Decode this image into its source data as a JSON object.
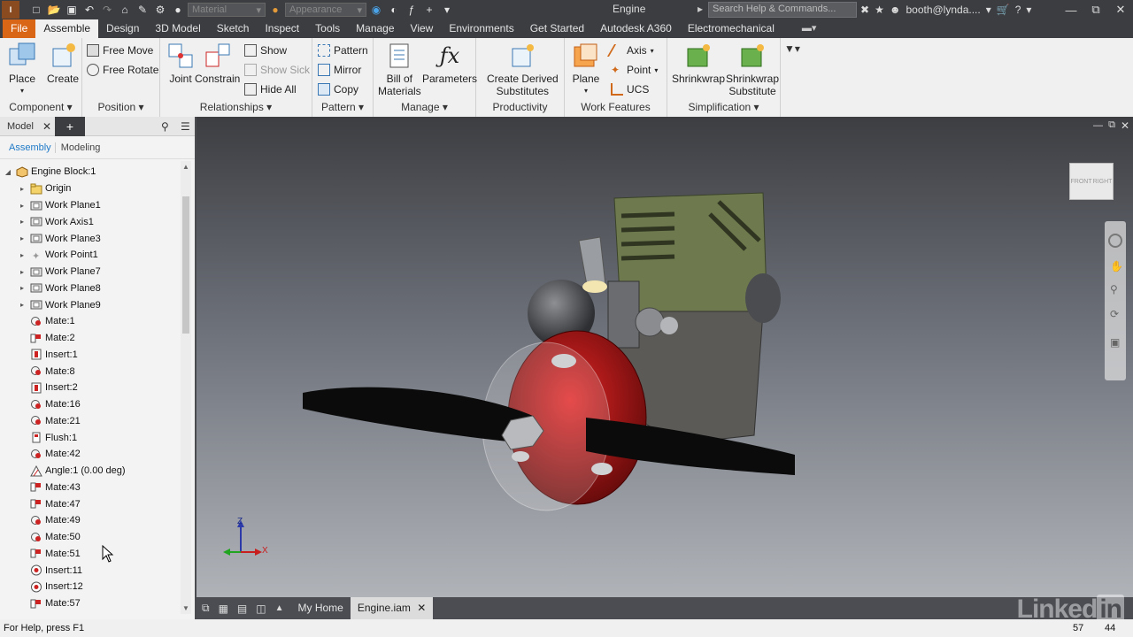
{
  "titlebar": {
    "app_logo": "I",
    "material_placeholder": "Material",
    "appearance_placeholder": "Appearance",
    "document_title": "Engine",
    "search_placeholder": "Search Help & Commands...",
    "user": "booth@lynda....",
    "help": "?"
  },
  "tabs": [
    "File",
    "Assemble",
    "Design",
    "3D Model",
    "Sketch",
    "Inspect",
    "Tools",
    "Manage",
    "View",
    "Environments",
    "Get Started",
    "Autodesk A360",
    "Electromechanical"
  ],
  "ribbon": {
    "component": {
      "title": "Component",
      "place": "Place",
      "create": "Create"
    },
    "position": {
      "title": "Position",
      "free_move": "Free Move",
      "free_rotate": "Free Rotate"
    },
    "relationships": {
      "title": "Relationships",
      "joint": "Joint",
      "constrain": "Constrain",
      "show": "Show",
      "show_sick": "Show Sick",
      "hide_all": "Hide All"
    },
    "pattern": {
      "title": "Pattern",
      "pattern": "Pattern",
      "mirror": "Mirror",
      "copy": "Copy"
    },
    "manage": {
      "title": "Manage",
      "bom_line1": "Bill of",
      "bom_line2": "Materials",
      "parameters": "Parameters"
    },
    "productivity": {
      "title": "Productivity",
      "line1": "Create Derived",
      "line2": "Substitutes"
    },
    "work_features": {
      "title": "Work Features",
      "plane": "Plane",
      "axis": "Axis",
      "point": "Point",
      "ucs": "UCS"
    },
    "simplification": {
      "title": "Simplification",
      "shrinkwrap": "Shrinkwrap",
      "sub_line1": "Shrinkwrap",
      "sub_line2": "Substitute"
    }
  },
  "browser": {
    "title": "Model",
    "tab_assembly": "Assembly",
    "tab_modeling": "Modeling",
    "root": "Engine Block:1",
    "items": [
      {
        "label": "Origin",
        "icon": "folder",
        "expandable": true
      },
      {
        "label": "Work Plane1",
        "icon": "part",
        "expandable": true
      },
      {
        "label": "Work Axis1",
        "icon": "part",
        "expandable": true
      },
      {
        "label": "Work Plane3",
        "icon": "part",
        "expandable": true
      },
      {
        "label": "Work Point1",
        "icon": "point",
        "expandable": true
      },
      {
        "label": "Work Plane7",
        "icon": "part",
        "expandable": true
      },
      {
        "label": "Work Plane8",
        "icon": "part",
        "expandable": true
      },
      {
        "label": "Work Plane9",
        "icon": "part",
        "expandable": true
      },
      {
        "label": "Mate:1",
        "icon": "mate",
        "expandable": false
      },
      {
        "label": "Mate:2",
        "icon": "mate-flush",
        "expandable": false
      },
      {
        "label": "Insert:1",
        "icon": "insert",
        "expandable": false
      },
      {
        "label": "Mate:8",
        "icon": "mate",
        "expandable": false
      },
      {
        "label": "Insert:2",
        "icon": "insert",
        "expandable": false
      },
      {
        "label": "Mate:16",
        "icon": "mate",
        "expandable": false
      },
      {
        "label": "Mate:21",
        "icon": "mate",
        "expandable": false
      },
      {
        "label": "Flush:1",
        "icon": "flush",
        "expandable": false
      },
      {
        "label": "Mate:42",
        "icon": "mate",
        "expandable": false
      },
      {
        "label": "Angle:1 (0.00 deg)",
        "icon": "angle",
        "expandable": false
      },
      {
        "label": "Mate:43",
        "icon": "mate-flush",
        "expandable": false
      },
      {
        "label": "Mate:47",
        "icon": "mate-flush",
        "expandable": false
      },
      {
        "label": "Mate:49",
        "icon": "mate",
        "expandable": false
      },
      {
        "label": "Mate:50",
        "icon": "mate",
        "expandable": false
      },
      {
        "label": "Mate:51",
        "icon": "mate-flush",
        "expandable": false
      },
      {
        "label": "Insert:11",
        "icon": "insert-round",
        "expandable": false
      },
      {
        "label": "Insert:12",
        "icon": "insert-round",
        "expandable": false
      },
      {
        "label": "Mate:57",
        "icon": "mate-flush",
        "expandable": false
      }
    ]
  },
  "viewcube": {
    "front": "FRONT",
    "right": "RIGHT"
  },
  "triad": {
    "z": "Z",
    "x": "X"
  },
  "bottom_tabs": {
    "home": "My Home",
    "doc": "Engine.iam"
  },
  "status": {
    "help": "For Help, press F1",
    "count1": "57",
    "count2": "44"
  },
  "watermark": {
    "text": "Linked",
    "in": "in"
  },
  "colors": {
    "accent": "#d96516",
    "viewport_top": "#3d3e42",
    "viewport_bottom": "#b0b3b8"
  }
}
